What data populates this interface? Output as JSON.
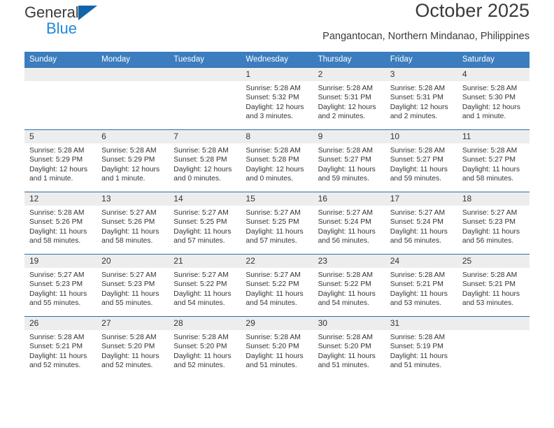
{
  "brand": {
    "line1": "General",
    "line2": "Blue",
    "logo_icon": "triangle-logo-icon"
  },
  "header": {
    "title": "October 2025",
    "subtitle": "Pangantocan, Northern Mindanao, Philippines"
  },
  "colors": {
    "header_row_bg": "#3b7dbf",
    "day_number_bg": "#ededed",
    "cell_border": "#2b6ca8",
    "brand_blue": "#2288dd",
    "logo_blue": "#1263ab",
    "text": "#333333"
  },
  "weekday_headers": [
    "Sunday",
    "Monday",
    "Tuesday",
    "Wednesday",
    "Thursday",
    "Friday",
    "Saturday"
  ],
  "labels": {
    "sunrise_prefix": "Sunrise:",
    "sunset_prefix": "Sunset:",
    "daylight_prefix": "Daylight:"
  },
  "weeks": [
    [
      {
        "day": "",
        "blank": true
      },
      {
        "day": "",
        "blank": true
      },
      {
        "day": "",
        "blank": true
      },
      {
        "day": "1",
        "sunrise": "Sunrise: 5:28 AM",
        "sunset": "Sunset: 5:32 PM",
        "daylight": "Daylight: 12 hours and 3 minutes."
      },
      {
        "day": "2",
        "sunrise": "Sunrise: 5:28 AM",
        "sunset": "Sunset: 5:31 PM",
        "daylight": "Daylight: 12 hours and 2 minutes."
      },
      {
        "day": "3",
        "sunrise": "Sunrise: 5:28 AM",
        "sunset": "Sunset: 5:31 PM",
        "daylight": "Daylight: 12 hours and 2 minutes."
      },
      {
        "day": "4",
        "sunrise": "Sunrise: 5:28 AM",
        "sunset": "Sunset: 5:30 PM",
        "daylight": "Daylight: 12 hours and 1 minute."
      }
    ],
    [
      {
        "day": "5",
        "sunrise": "Sunrise: 5:28 AM",
        "sunset": "Sunset: 5:29 PM",
        "daylight": "Daylight: 12 hours and 1 minute."
      },
      {
        "day": "6",
        "sunrise": "Sunrise: 5:28 AM",
        "sunset": "Sunset: 5:29 PM",
        "daylight": "Daylight: 12 hours and 1 minute."
      },
      {
        "day": "7",
        "sunrise": "Sunrise: 5:28 AM",
        "sunset": "Sunset: 5:28 PM",
        "daylight": "Daylight: 12 hours and 0 minutes."
      },
      {
        "day": "8",
        "sunrise": "Sunrise: 5:28 AM",
        "sunset": "Sunset: 5:28 PM",
        "daylight": "Daylight: 12 hours and 0 minutes."
      },
      {
        "day": "9",
        "sunrise": "Sunrise: 5:28 AM",
        "sunset": "Sunset: 5:27 PM",
        "daylight": "Daylight: 11 hours and 59 minutes."
      },
      {
        "day": "10",
        "sunrise": "Sunrise: 5:28 AM",
        "sunset": "Sunset: 5:27 PM",
        "daylight": "Daylight: 11 hours and 59 minutes."
      },
      {
        "day": "11",
        "sunrise": "Sunrise: 5:28 AM",
        "sunset": "Sunset: 5:27 PM",
        "daylight": "Daylight: 11 hours and 58 minutes."
      }
    ],
    [
      {
        "day": "12",
        "sunrise": "Sunrise: 5:28 AM",
        "sunset": "Sunset: 5:26 PM",
        "daylight": "Daylight: 11 hours and 58 minutes."
      },
      {
        "day": "13",
        "sunrise": "Sunrise: 5:27 AM",
        "sunset": "Sunset: 5:26 PM",
        "daylight": "Daylight: 11 hours and 58 minutes."
      },
      {
        "day": "14",
        "sunrise": "Sunrise: 5:27 AM",
        "sunset": "Sunset: 5:25 PM",
        "daylight": "Daylight: 11 hours and 57 minutes."
      },
      {
        "day": "15",
        "sunrise": "Sunrise: 5:27 AM",
        "sunset": "Sunset: 5:25 PM",
        "daylight": "Daylight: 11 hours and 57 minutes."
      },
      {
        "day": "16",
        "sunrise": "Sunrise: 5:27 AM",
        "sunset": "Sunset: 5:24 PM",
        "daylight": "Daylight: 11 hours and 56 minutes."
      },
      {
        "day": "17",
        "sunrise": "Sunrise: 5:27 AM",
        "sunset": "Sunset: 5:24 PM",
        "daylight": "Daylight: 11 hours and 56 minutes."
      },
      {
        "day": "18",
        "sunrise": "Sunrise: 5:27 AM",
        "sunset": "Sunset: 5:23 PM",
        "daylight": "Daylight: 11 hours and 56 minutes."
      }
    ],
    [
      {
        "day": "19",
        "sunrise": "Sunrise: 5:27 AM",
        "sunset": "Sunset: 5:23 PM",
        "daylight": "Daylight: 11 hours and 55 minutes."
      },
      {
        "day": "20",
        "sunrise": "Sunrise: 5:27 AM",
        "sunset": "Sunset: 5:23 PM",
        "daylight": "Daylight: 11 hours and 55 minutes."
      },
      {
        "day": "21",
        "sunrise": "Sunrise: 5:27 AM",
        "sunset": "Sunset: 5:22 PM",
        "daylight": "Daylight: 11 hours and 54 minutes."
      },
      {
        "day": "22",
        "sunrise": "Sunrise: 5:27 AM",
        "sunset": "Sunset: 5:22 PM",
        "daylight": "Daylight: 11 hours and 54 minutes."
      },
      {
        "day": "23",
        "sunrise": "Sunrise: 5:28 AM",
        "sunset": "Sunset: 5:22 PM",
        "daylight": "Daylight: 11 hours and 54 minutes."
      },
      {
        "day": "24",
        "sunrise": "Sunrise: 5:28 AM",
        "sunset": "Sunset: 5:21 PM",
        "daylight": "Daylight: 11 hours and 53 minutes."
      },
      {
        "day": "25",
        "sunrise": "Sunrise: 5:28 AM",
        "sunset": "Sunset: 5:21 PM",
        "daylight": "Daylight: 11 hours and 53 minutes."
      }
    ],
    [
      {
        "day": "26",
        "sunrise": "Sunrise: 5:28 AM",
        "sunset": "Sunset: 5:21 PM",
        "daylight": "Daylight: 11 hours and 52 minutes."
      },
      {
        "day": "27",
        "sunrise": "Sunrise: 5:28 AM",
        "sunset": "Sunset: 5:20 PM",
        "daylight": "Daylight: 11 hours and 52 minutes."
      },
      {
        "day": "28",
        "sunrise": "Sunrise: 5:28 AM",
        "sunset": "Sunset: 5:20 PM",
        "daylight": "Daylight: 11 hours and 52 minutes."
      },
      {
        "day": "29",
        "sunrise": "Sunrise: 5:28 AM",
        "sunset": "Sunset: 5:20 PM",
        "daylight": "Daylight: 11 hours and 51 minutes."
      },
      {
        "day": "30",
        "sunrise": "Sunrise: 5:28 AM",
        "sunset": "Sunset: 5:20 PM",
        "daylight": "Daylight: 11 hours and 51 minutes."
      },
      {
        "day": "31",
        "sunrise": "Sunrise: 5:28 AM",
        "sunset": "Sunset: 5:19 PM",
        "daylight": "Daylight: 11 hours and 51 minutes."
      },
      {
        "day": "",
        "blank": true
      }
    ]
  ]
}
